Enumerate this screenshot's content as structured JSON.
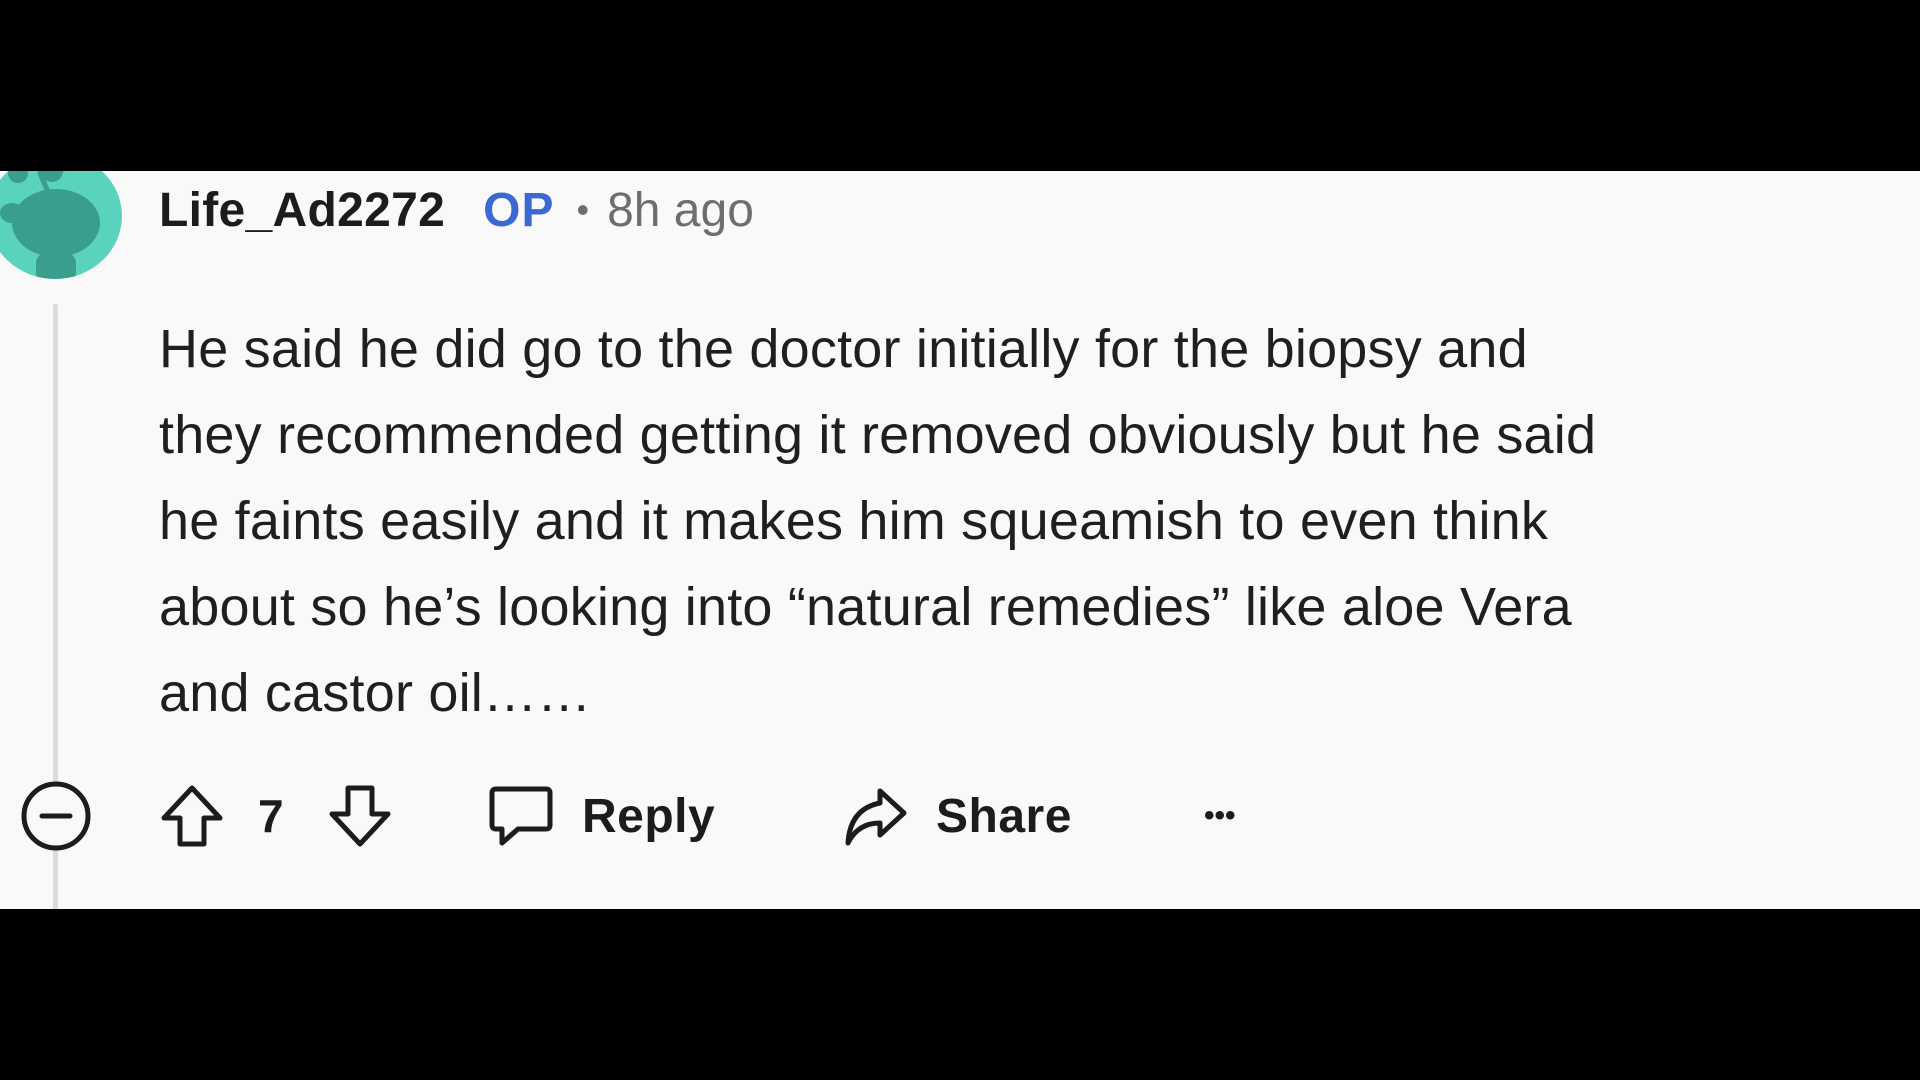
{
  "comment": {
    "author": "Life_Ad2272",
    "op_badge": "OP",
    "separator": "•",
    "timestamp": "8h ago",
    "body_lines": [
      "He said he did go to the doctor initially for the biopsy and",
      "they recommended getting it removed obviously but he said",
      "he faints easily and it makes him squeamish to even think",
      "about so he’s looking into “natural remedies” like aloe Vera",
      "and castor oil……"
    ],
    "vote_count": "7",
    "reply_label": "Reply",
    "share_label": "Share",
    "more_label": "•••"
  },
  "colors": {
    "background": "#f9f9f9",
    "frame": "#000000",
    "op_badge": "#3c68d1",
    "avatar": "#5ad3bd",
    "text": "#1c1c1c",
    "muted": "#6e6e6e"
  },
  "icons": [
    "collapse-icon",
    "upvote-icon",
    "downvote-icon",
    "comment-icon",
    "share-icon",
    "more-icon"
  ]
}
